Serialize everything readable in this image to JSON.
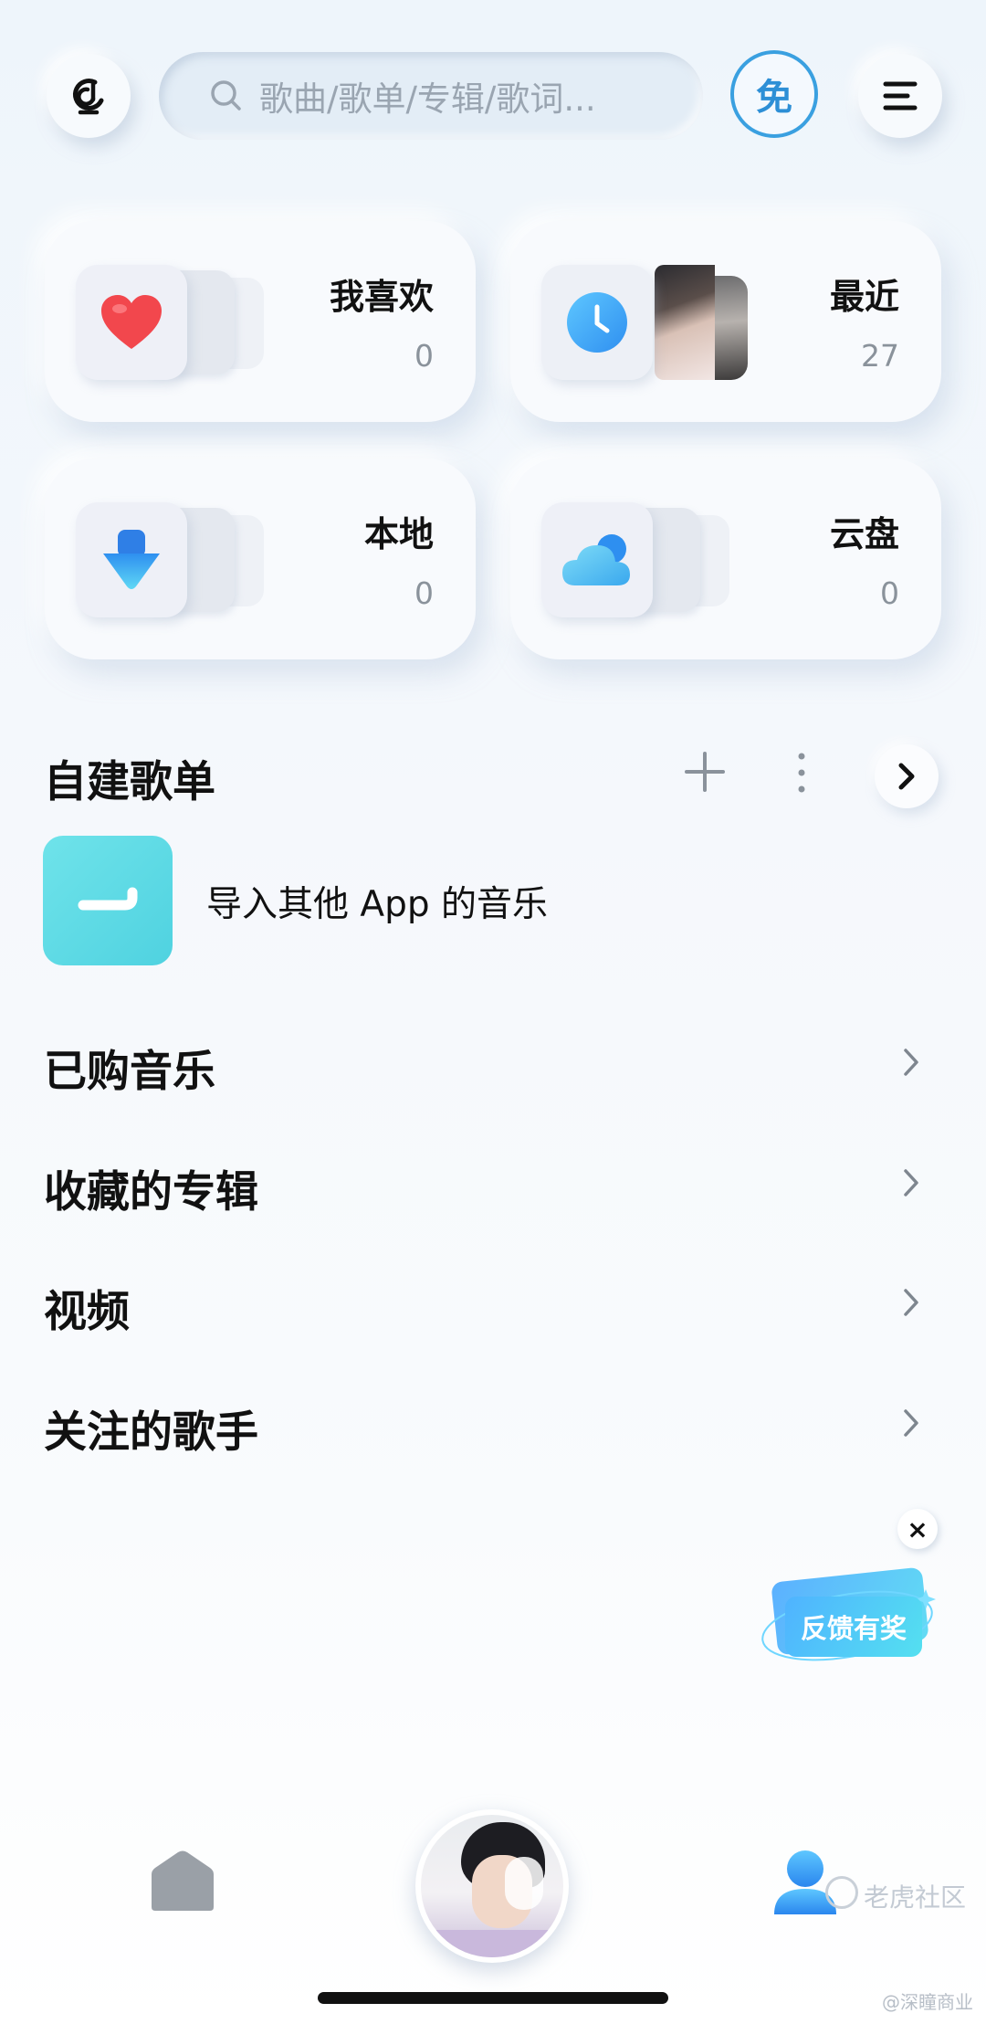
{
  "header": {
    "search_placeholder": "歌曲/歌单/专辑/歌词...",
    "free_badge": "免"
  },
  "quick_cards": [
    {
      "title": "我喜欢",
      "count": "0",
      "icon": "heart-icon"
    },
    {
      "title": "最近",
      "count": "27",
      "icon": "clock-icon"
    },
    {
      "title": "本地",
      "count": "0",
      "icon": "download-arrow-icon"
    },
    {
      "title": "云盘",
      "count": "0",
      "icon": "cloud-icon"
    }
  ],
  "playlists": {
    "title": "自建歌单",
    "import_label": "导入其他 App 的音乐"
  },
  "list": [
    {
      "label": "已购音乐"
    },
    {
      "label": "收藏的专辑"
    },
    {
      "label": "视频"
    },
    {
      "label": "关注的歌手"
    }
  ],
  "feedback": {
    "label": "反馈有奖",
    "close_glyph": "×"
  },
  "watermark": {
    "main": "老虎社区",
    "sub": "@深瞳商业"
  },
  "colors": {
    "accent": "#3aa0e0",
    "heart": "#f2474d",
    "import_tile": "#5ad8e4",
    "feedback": "#4fb3ff"
  }
}
